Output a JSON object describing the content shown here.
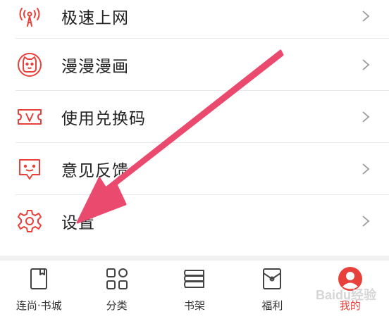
{
  "menu": {
    "items": [
      {
        "label": "极速上网",
        "icon": "wifi-signal-icon"
      },
      {
        "label": "漫漫漫画",
        "icon": "comic-cat-icon"
      },
      {
        "label": "使用兑换码",
        "icon": "redeem-ticket-icon"
      },
      {
        "label": "意见反馈",
        "icon": "feedback-chat-icon"
      },
      {
        "label": "设置",
        "icon": "gear-icon"
      }
    ]
  },
  "tabbar": {
    "tabs": [
      {
        "label": "连尚·书城",
        "icon": "bookstore-icon",
        "active": false
      },
      {
        "label": "分类",
        "icon": "category-grid-icon",
        "active": false
      },
      {
        "label": "书架",
        "icon": "bookshelf-icon",
        "active": false
      },
      {
        "label": "福利",
        "icon": "gift-envelope-icon",
        "active": false
      },
      {
        "label": "我的",
        "icon": "profile-avatar-icon",
        "active": true
      }
    ]
  },
  "colors": {
    "accent": "#e8403a",
    "arrow": "#e94a6e",
    "text": "#222222",
    "divider": "#e9e9e9"
  },
  "watermark": {
    "text": "Baidu经验"
  }
}
